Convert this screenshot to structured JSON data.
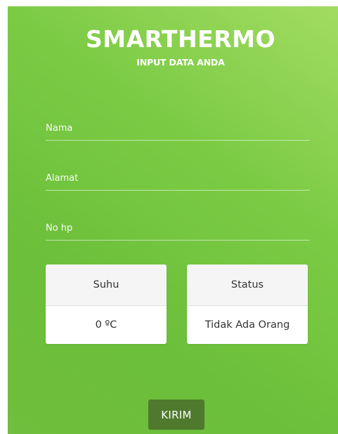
{
  "header": {
    "title": "SMARTHERMO",
    "subtitle": "INPUT DATA ANDA"
  },
  "form": {
    "fields": [
      {
        "placeholder": "Nama",
        "value": ""
      },
      {
        "placeholder": "Alamat",
        "value": ""
      },
      {
        "placeholder": "No hp",
        "value": ""
      }
    ]
  },
  "cards": {
    "temperature": {
      "label": "Suhu",
      "value": "0 ºC"
    },
    "status": {
      "label": "Status",
      "value": "Tidak Ada Orang"
    }
  },
  "submit": {
    "label": "KIRIM"
  },
  "colors": {
    "background_gradient_light": "#a2dc62",
    "background_gradient_dark": "#6cbf3a",
    "button": "#4f7a2d",
    "card_header": "#f5f5f5"
  }
}
